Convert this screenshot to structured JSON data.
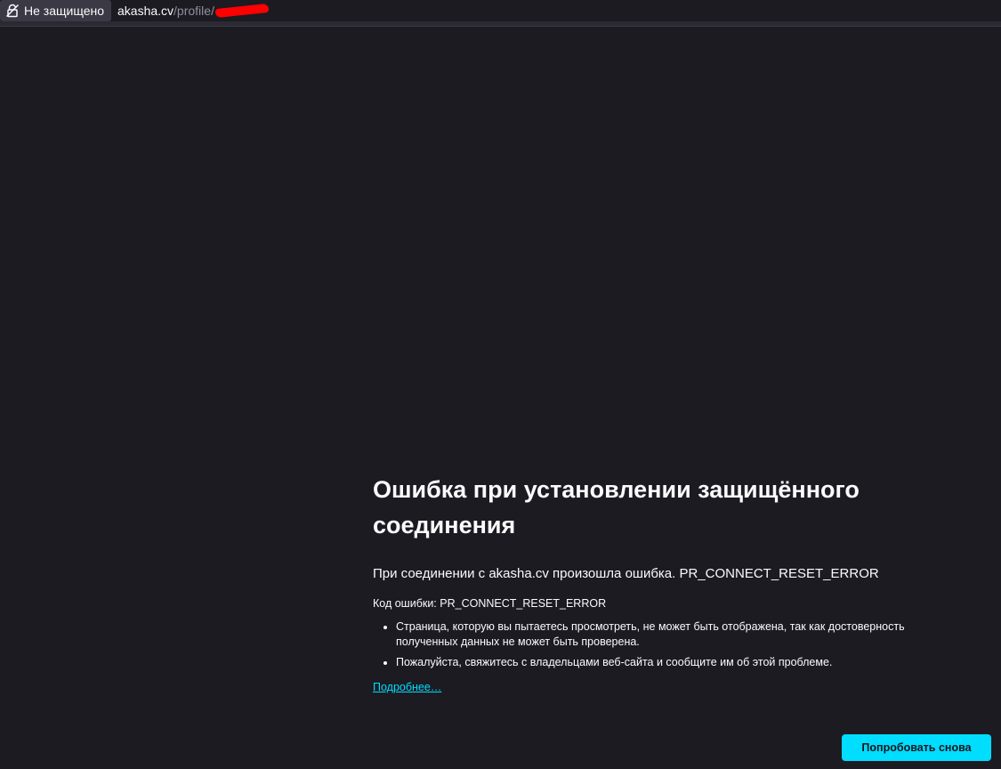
{
  "urlbar": {
    "security_label": "Не защищено",
    "security_icon": "insecure-lock-icon",
    "url_host": "akasha.cv",
    "url_path": "/profile/",
    "redaction_color": "#ff0000"
  },
  "error_page": {
    "title": "Ошибка при установлении защищённого соединения",
    "intro": "При соединении с akasha.cv произошла ошибка. PR_CONNECT_RESET_ERROR",
    "error_code_label": "Код ошибки:",
    "error_code_value": "PR_CONNECT_RESET_ERROR",
    "bullets": [
      "Страница, которую вы пытаетесь просмотреть, не может быть отображена, так как достоверность полученных данных не может быть проверена.",
      "Пожалуйста, свяжитесь с владельцами веб-сайта и сообщите им об этой проблеме."
    ],
    "learn_more": "Подробнее…",
    "retry_button": "Попробовать снова"
  },
  "colors": {
    "background": "#1c1b22",
    "accent": "#00ddff",
    "text": "#fbfbfe"
  }
}
